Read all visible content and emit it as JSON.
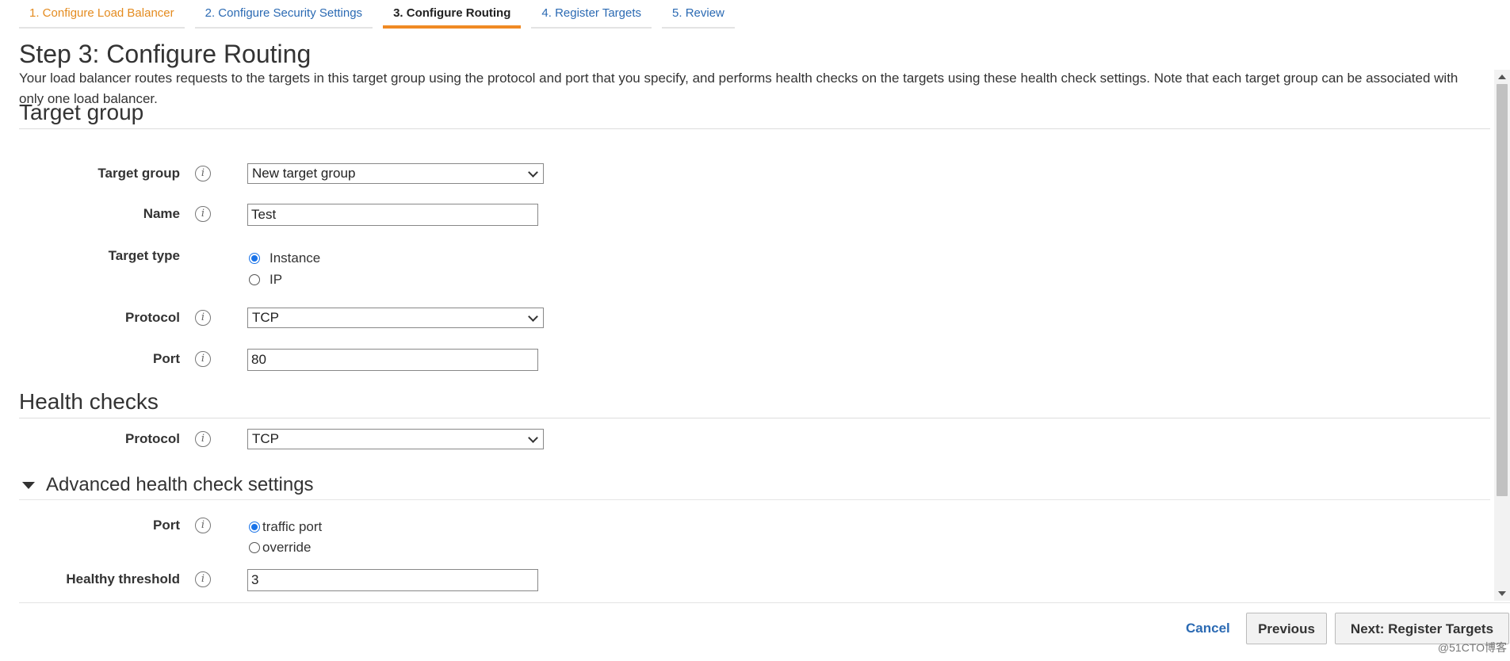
{
  "wizard": {
    "tabs": [
      {
        "label": "1. Configure Load Balancer",
        "state": "done"
      },
      {
        "label": "2. Configure Security Settings",
        "state": "pending"
      },
      {
        "label": "3. Configure Routing",
        "state": "active"
      },
      {
        "label": "4. Register Targets",
        "state": "pending"
      },
      {
        "label": "5. Review",
        "state": "pending"
      }
    ]
  },
  "page": {
    "title": "Step 3: Configure Routing",
    "description": "Your load balancer routes requests to the targets in this target group using the protocol and port that you specify, and performs health checks on the targets using these health check settings. Note that each target group can be associated with only one load balancer."
  },
  "target_group": {
    "heading": "Target group",
    "target_group_label": "Target group",
    "target_group_value": "New target group",
    "name_label": "Name",
    "name_value": "Test",
    "target_type_label": "Target type",
    "target_type_options": [
      "Instance",
      "IP"
    ],
    "target_type_selected": "Instance",
    "protocol_label": "Protocol",
    "protocol_value": "TCP",
    "port_label": "Port",
    "port_value": "80"
  },
  "health_checks": {
    "heading": "Health checks",
    "protocol_label": "Protocol",
    "protocol_value": "TCP"
  },
  "advanced": {
    "heading": "Advanced health check settings",
    "port_label": "Port",
    "port_options": [
      "traffic port",
      "override"
    ],
    "port_selected": "traffic port",
    "healthy_threshold_label": "Healthy threshold",
    "healthy_threshold_value": "3"
  },
  "info_glyph": "i",
  "footer": {
    "cancel_label": "Cancel",
    "previous_label": "Previous",
    "next_label": "Next: Register Targets"
  },
  "watermark": "@51CTO博客",
  "colors": {
    "accent": "#f08a24",
    "link": "#2b6ab3",
    "done_tab": "#e48b1f",
    "radio": "#1a73e8"
  }
}
